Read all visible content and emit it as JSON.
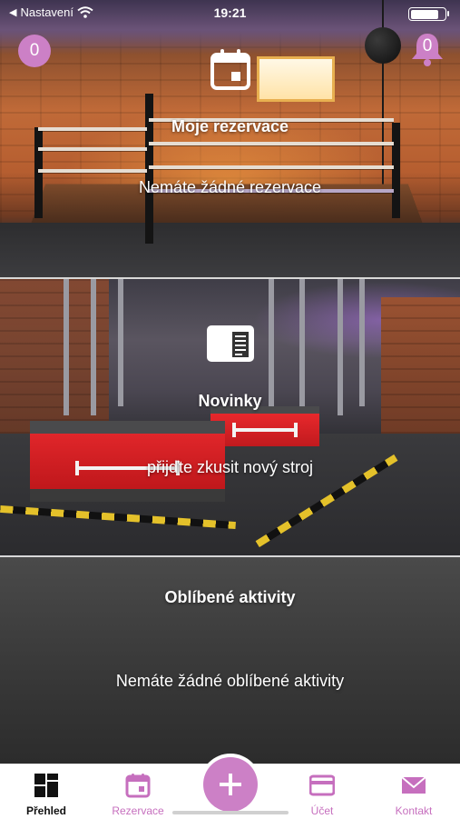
{
  "status_bar": {
    "carrier": "Nastavení",
    "time": "19:21",
    "battery_percent": 0.85
  },
  "header": {
    "left_badge_count": "0",
    "notification_count": "0"
  },
  "reservations": {
    "title": "Moje rezervace",
    "empty_text": "Nemáte žádné rezervace",
    "icon": "calendar-icon"
  },
  "news": {
    "title": "Novinky",
    "item_text": "přijďte zkusit nový stroj",
    "icon": "newspaper-icon"
  },
  "favorites": {
    "title": "Oblíbené aktivity",
    "empty_text": "Nemáte žádné oblíbené aktivity"
  },
  "tab_bar": {
    "items": [
      {
        "label": "Přehled",
        "icon": "dashboard-icon",
        "active": true
      },
      {
        "label": "Rezervace",
        "icon": "calendar-icon",
        "active": false
      },
      {
        "label": "",
        "icon": "plus-icon",
        "active": false
      },
      {
        "label": "Účet",
        "icon": "credit-card-icon",
        "active": false
      },
      {
        "label": "Kontakt",
        "icon": "envelope-icon",
        "active": false
      }
    ]
  },
  "colors": {
    "accent": "#cc80c6",
    "tab_background": "#ffffff",
    "active_text": "#111111"
  }
}
